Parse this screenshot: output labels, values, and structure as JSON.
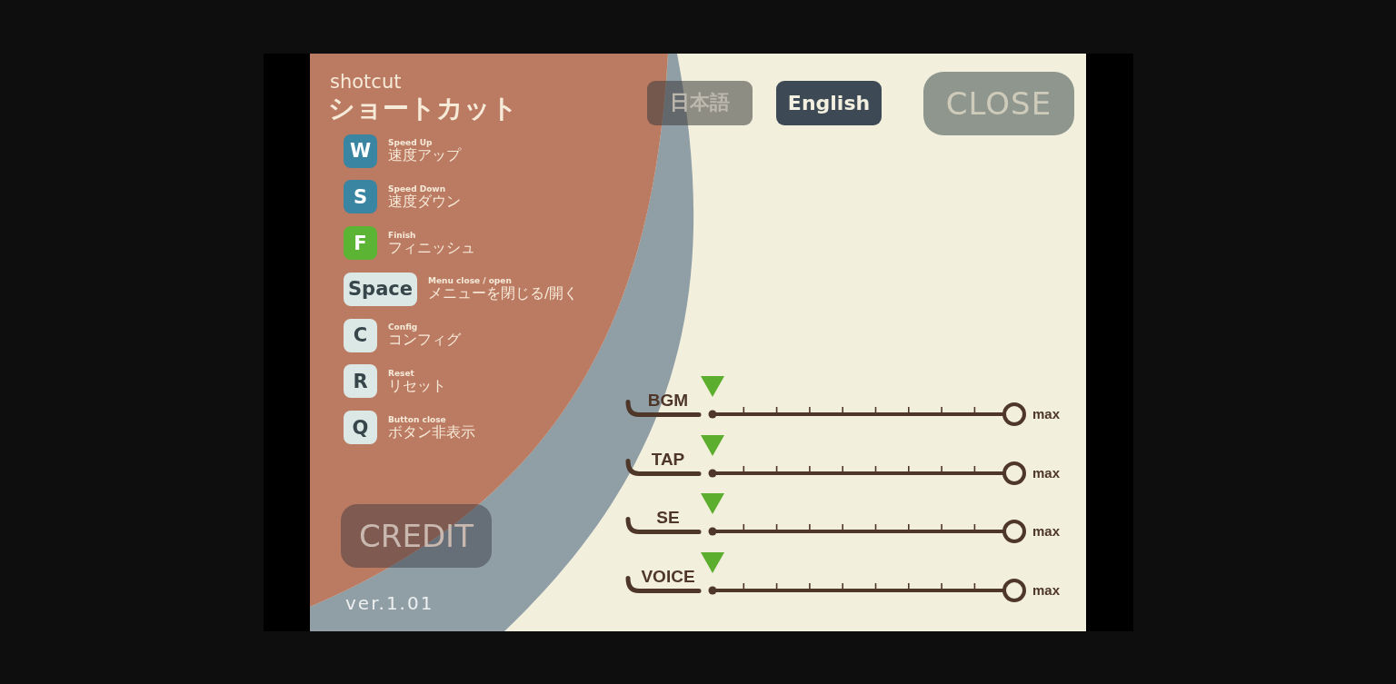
{
  "title": {
    "subtitle": "shotcut",
    "heading": "ショートカット"
  },
  "shortcuts": [
    {
      "key": "W",
      "color": "#3a86a2",
      "caption": "Speed Up",
      "label": "速度アップ"
    },
    {
      "key": "S",
      "color": "#3a86a2",
      "caption": "Speed Down",
      "label": "速度ダウン"
    },
    {
      "key": "F",
      "color": "#5bb434",
      "caption": "Finish",
      "label": "フィニッシュ"
    },
    {
      "key": "Space",
      "color": "#dce8e5",
      "caption": "Menu close / open",
      "label": "メニューを閉じる/開く"
    },
    {
      "key": "C",
      "color": "#dce8e5",
      "caption": "Config",
      "label": "コンフィグ"
    },
    {
      "key": "R",
      "color": "#dce8e5",
      "caption": "Reset",
      "label": "リセット"
    },
    {
      "key": "Q",
      "color": "#dce8e5",
      "caption": "Button close",
      "label": "ボタン非表示"
    }
  ],
  "credit_button": {
    "label": "CREDIT"
  },
  "version": "ver.1.01",
  "language_tabs": [
    {
      "label": "日本語",
      "selected": false
    },
    {
      "label": "English",
      "selected": true
    }
  ],
  "close_button": {
    "label": "CLOSE"
  },
  "volumes": [
    {
      "name": "BGM",
      "level": 0,
      "max_label": "max"
    },
    {
      "name": "TAP",
      "level": 0,
      "max_label": "max"
    },
    {
      "name": "SE",
      "level": 0,
      "max_label": "max"
    },
    {
      "name": "VOICE",
      "level": 0,
      "max_label": "max"
    }
  ]
}
